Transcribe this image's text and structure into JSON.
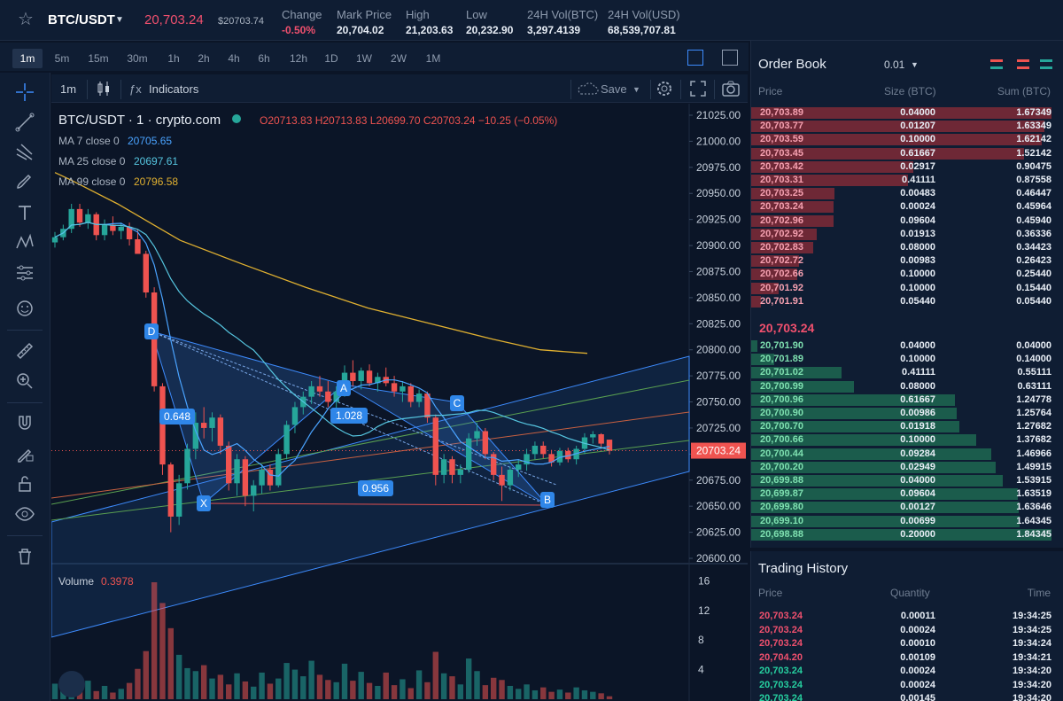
{
  "header": {
    "pair": "BTC/USDT",
    "last_price": "20,703.24",
    "last_price_usd": "$20703.74",
    "stats": [
      {
        "label": "Change",
        "value": "-0.50%",
        "negative": true
      },
      {
        "label": "Mark Price",
        "value": "20,704.02",
        "negative": false
      },
      {
        "label": "High",
        "value": "21,203.63",
        "negative": false
      },
      {
        "label": "Low",
        "value": "20,232.90",
        "negative": false
      },
      {
        "label": "24H Vol(BTC)",
        "value": "3,297.4139",
        "negative": false
      },
      {
        "label": "24H Vol(USD)",
        "value": "68,539,707.81",
        "negative": false
      }
    ]
  },
  "intervals": [
    "1m",
    "5m",
    "15m",
    "30m",
    "1h",
    "2h",
    "4h",
    "6h",
    "12h",
    "1D",
    "1W",
    "2W",
    "1M"
  ],
  "active_interval": "1m",
  "chart_toolbar": {
    "interval": "1m",
    "indicators_label": "Indicators",
    "save_label": "Save"
  },
  "chart_legend": {
    "title": "BTC/USDT · 1 · crypto.com",
    "ohlc": "O20713.83 H20713.83 L20699.70 C20703.24 −10.25 (−0.05%)",
    "ma7_label": "MA 7 close 0",
    "ma7_value": "20705.65",
    "ma25_label": "MA 25 close 0",
    "ma25_value": "20697.61",
    "ma99_label": "MA 99 close 0",
    "ma99_value": "20796.58",
    "volume_label": "Volume",
    "volume_value": "0.3978"
  },
  "colors": {
    "up": "#26a69a",
    "down": "#ef5350",
    "ma7": "#4aa3ff",
    "ma25": "#56c6e0",
    "ma99": "#e0b030",
    "background": "#0b1527",
    "panel": "#0f1d33"
  },
  "chart_data": {
    "type": "candlestick",
    "price_axis_ticks": [
      "21025.00",
      "21000.00",
      "20975.00",
      "20950.00",
      "20925.00",
      "20900.00",
      "20875.00",
      "20850.00",
      "20825.00",
      "20800.00",
      "20775.00",
      "20750.00",
      "20725.00",
      "20700.00",
      "20675.00",
      "20650.00",
      "20625.00",
      "20600.00"
    ],
    "price_range": [
      20600,
      21025
    ],
    "current_price_label": "20703.24",
    "current_price": 20703.24,
    "volume_axis_ticks": [
      "16",
      "12",
      "8",
      "4"
    ],
    "volume_range": [
      0,
      16
    ],
    "pattern_points": [
      "X",
      "A",
      "B",
      "C",
      "D"
    ],
    "pattern_ratios": [
      "0.648",
      "1.028",
      "0.956"
    ],
    "candles": [
      {
        "o": 20903,
        "h": 20913,
        "l": 20898,
        "c": 20908
      },
      {
        "o": 20908,
        "h": 20920,
        "l": 20905,
        "c": 20916
      },
      {
        "o": 20916,
        "h": 20940,
        "l": 20912,
        "c": 20935
      },
      {
        "o": 20935,
        "h": 20940,
        "l": 20918,
        "c": 20922
      },
      {
        "o": 20922,
        "h": 20935,
        "l": 20916,
        "c": 20930
      },
      {
        "o": 20930,
        "h": 20932,
        "l": 20905,
        "c": 20910
      },
      {
        "o": 20910,
        "h": 20925,
        "l": 20905,
        "c": 20920
      },
      {
        "o": 20920,
        "h": 20928,
        "l": 20910,
        "c": 20914
      },
      {
        "o": 20914,
        "h": 20922,
        "l": 20906,
        "c": 20918
      },
      {
        "o": 20918,
        "h": 20922,
        "l": 20900,
        "c": 20906
      },
      {
        "o": 20906,
        "h": 20915,
        "l": 20895,
        "c": 20892
      },
      {
        "o": 20892,
        "h": 20895,
        "l": 20850,
        "c": 20855
      },
      {
        "o": 20855,
        "h": 20860,
        "l": 20760,
        "c": 20765
      },
      {
        "o": 20765,
        "h": 20768,
        "l": 20680,
        "c": 20690
      },
      {
        "o": 20690,
        "h": 20692,
        "l": 20625,
        "c": 20640
      },
      {
        "o": 20640,
        "h": 20680,
        "l": 20632,
        "c": 20672
      },
      {
        "o": 20672,
        "h": 20710,
        "l": 20666,
        "c": 20705
      },
      {
        "o": 20705,
        "h": 20740,
        "l": 20695,
        "c": 20730
      },
      {
        "o": 20730,
        "h": 20745,
        "l": 20715,
        "c": 20725
      },
      {
        "o": 20725,
        "h": 20740,
        "l": 20712,
        "c": 20735
      },
      {
        "o": 20735,
        "h": 20738,
        "l": 20700,
        "c": 20708
      },
      {
        "o": 20708,
        "h": 20712,
        "l": 20665,
        "c": 20672
      },
      {
        "o": 20672,
        "h": 20700,
        "l": 20660,
        "c": 20695
      },
      {
        "o": 20695,
        "h": 20698,
        "l": 20650,
        "c": 20660
      },
      {
        "o": 20660,
        "h": 20675,
        "l": 20645,
        "c": 20670
      },
      {
        "o": 20670,
        "h": 20690,
        "l": 20662,
        "c": 20685
      },
      {
        "o": 20685,
        "h": 20690,
        "l": 20665,
        "c": 20670
      },
      {
        "o": 20670,
        "h": 20705,
        "l": 20668,
        "c": 20700
      },
      {
        "o": 20700,
        "h": 20732,
        "l": 20695,
        "c": 20728
      },
      {
        "o": 20728,
        "h": 20750,
        "l": 20720,
        "c": 20745
      },
      {
        "o": 20745,
        "h": 20760,
        "l": 20738,
        "c": 20755
      },
      {
        "o": 20755,
        "h": 20770,
        "l": 20748,
        "c": 20765
      },
      {
        "o": 20765,
        "h": 20775,
        "l": 20755,
        "c": 20760
      },
      {
        "o": 20760,
        "h": 20770,
        "l": 20745,
        "c": 20750
      },
      {
        "o": 20750,
        "h": 20765,
        "l": 20742,
        "c": 20760
      },
      {
        "o": 20760,
        "h": 20785,
        "l": 20755,
        "c": 20778
      },
      {
        "o": 20778,
        "h": 20790,
        "l": 20765,
        "c": 20770
      },
      {
        "o": 20770,
        "h": 20783,
        "l": 20762,
        "c": 20780
      },
      {
        "o": 20780,
        "h": 20786,
        "l": 20765,
        "c": 20768
      },
      {
        "o": 20768,
        "h": 20778,
        "l": 20760,
        "c": 20774
      },
      {
        "o": 20774,
        "h": 20783,
        "l": 20765,
        "c": 20768
      },
      {
        "o": 20768,
        "h": 20775,
        "l": 20755,
        "c": 20760
      },
      {
        "o": 20760,
        "h": 20770,
        "l": 20750,
        "c": 20765
      },
      {
        "o": 20765,
        "h": 20768,
        "l": 20745,
        "c": 20750
      },
      {
        "o": 20750,
        "h": 20762,
        "l": 20745,
        "c": 20758
      },
      {
        "o": 20758,
        "h": 20760,
        "l": 20730,
        "c": 20735
      },
      {
        "o": 20735,
        "h": 20738,
        "l": 20670,
        "c": 20680
      },
      {
        "o": 20680,
        "h": 20700,
        "l": 20672,
        "c": 20695
      },
      {
        "o": 20695,
        "h": 20698,
        "l": 20672,
        "c": 20680
      },
      {
        "o": 20680,
        "h": 20690,
        "l": 20672,
        "c": 20685
      },
      {
        "o": 20685,
        "h": 20720,
        "l": 20682,
        "c": 20715
      },
      {
        "o": 20715,
        "h": 20730,
        "l": 20708,
        "c": 20722
      },
      {
        "o": 20722,
        "h": 20725,
        "l": 20695,
        "c": 20700
      },
      {
        "o": 20700,
        "h": 20702,
        "l": 20675,
        "c": 20680
      },
      {
        "o": 20680,
        "h": 20688,
        "l": 20655,
        "c": 20670
      },
      {
        "o": 20670,
        "h": 20688,
        "l": 20665,
        "c": 20685
      },
      {
        "o": 20685,
        "h": 20695,
        "l": 20678,
        "c": 20690
      },
      {
        "o": 20690,
        "h": 20705,
        "l": 20684,
        "c": 20700
      },
      {
        "o": 20700,
        "h": 20712,
        "l": 20695,
        "c": 20708
      },
      {
        "o": 20708,
        "h": 20712,
        "l": 20696,
        "c": 20700
      },
      {
        "o": 20700,
        "h": 20704,
        "l": 20688,
        "c": 20692
      },
      {
        "o": 20692,
        "h": 20706,
        "l": 20689,
        "c": 20703
      },
      {
        "o": 20703,
        "h": 20706,
        "l": 20692,
        "c": 20695
      },
      {
        "o": 20695,
        "h": 20708,
        "l": 20690,
        "c": 20705
      },
      {
        "o": 20705,
        "h": 20720,
        "l": 20700,
        "c": 20716
      },
      {
        "o": 20716,
        "h": 20722,
        "l": 20710,
        "c": 20719
      },
      {
        "o": 20719,
        "h": 20720,
        "l": 20705,
        "c": 20710
      },
      {
        "o": 20713.83,
        "h": 20713.83,
        "l": 20699.7,
        "c": 20703.24
      }
    ],
    "volumes": [
      2.1,
      1.6,
      3.4,
      1.2,
      2.5,
      1.1,
      1.8,
      0.9,
      1.4,
      2.2,
      4.1,
      6.5,
      15.8,
      13.0,
      9.6,
      6.0,
      4.2,
      3.8,
      4.6,
      2.8,
      3.3,
      2.0,
      3.5,
      2.4,
      1.7,
      3.6,
      2.1,
      2.8,
      4.9,
      4.0,
      3.1,
      5.2,
      3.3,
      2.6,
      2.3,
      4.8,
      2.5,
      3.7,
      2.2,
      1.8,
      3.6,
      1.9,
      2.7,
      1.5,
      3.9,
      2.3,
      6.4,
      3.5,
      3.1,
      2.0,
      5.5,
      3.8,
      1.9,
      2.9,
      2.6,
      1.8,
      1.4,
      2.0,
      1.2,
      1.6,
      1.0,
      1.3,
      0.9,
      1.6,
      1.2,
      1.0,
      0.8,
      0.4
    ],
    "ma99": [
      [
        0,
        20970
      ],
      [
        10,
        20963
      ],
      [
        40,
        20940
      ],
      [
        80,
        20905
      ],
      [
        120,
        20882
      ],
      [
        160,
        20860
      ],
      [
        200,
        20840
      ],
      [
        240,
        20825
      ],
      [
        280,
        20810
      ],
      [
        310,
        20800
      ],
      [
        340,
        20796.58
      ]
    ]
  },
  "orderbook": {
    "title": "Order Book",
    "aggregation": "0.01",
    "headers": [
      "Price",
      "Size (BTC)",
      "Sum (BTC)"
    ],
    "mid_price": "20,703.24",
    "asks": [
      {
        "price": "20,703.89",
        "size": "0.04000",
        "sum": "1.67349",
        "depth": 1.0
      },
      {
        "price": "20,703.77",
        "size": "0.01207",
        "sum": "1.63349",
        "depth": 0.976
      },
      {
        "price": "20,703.59",
        "size": "0.10000",
        "sum": "1.62142",
        "depth": 0.969
      },
      {
        "price": "20,703.45",
        "size": "0.61667",
        "sum": "1.52142",
        "depth": 0.909
      },
      {
        "price": "20,703.42",
        "size": "0.02917",
        "sum": "0.90475",
        "depth": 0.541
      },
      {
        "price": "20,703.31",
        "size": "0.41111",
        "sum": "0.87558",
        "depth": 0.523
      },
      {
        "price": "20,703.25",
        "size": "0.00483",
        "sum": "0.46447",
        "depth": 0.278
      },
      {
        "price": "20,703.24",
        "size": "0.00024",
        "sum": "0.45964",
        "depth": 0.275
      },
      {
        "price": "20,702.96",
        "size": "0.09604",
        "sum": "0.45940",
        "depth": 0.275
      },
      {
        "price": "20,702.92",
        "size": "0.01913",
        "sum": "0.36336",
        "depth": 0.217
      },
      {
        "price": "20,702.83",
        "size": "0.08000",
        "sum": "0.34423",
        "depth": 0.206
      },
      {
        "price": "20,702.72",
        "size": "0.00983",
        "sum": "0.26423",
        "depth": 0.158
      },
      {
        "price": "20,702.66",
        "size": "0.10000",
        "sum": "0.25440",
        "depth": 0.152
      },
      {
        "price": "20,701.92",
        "size": "0.10000",
        "sum": "0.15440",
        "depth": 0.092
      },
      {
        "price": "20,701.91",
        "size": "0.05440",
        "sum": "0.05440",
        "depth": 0.033
      }
    ],
    "bids": [
      {
        "price": "20,701.90",
        "size": "0.04000",
        "sum": "0.04000",
        "depth": 0.022
      },
      {
        "price": "20,701.89",
        "size": "0.10000",
        "sum": "0.14000",
        "depth": 0.076
      },
      {
        "price": "20,701.02",
        "size": "0.41111",
        "sum": "0.55111",
        "depth": 0.3
      },
      {
        "price": "20,700.99",
        "size": "0.08000",
        "sum": "0.63111",
        "depth": 0.343
      },
      {
        "price": "20,700.96",
        "size": "0.61667",
        "sum": "1.24778",
        "depth": 0.678
      },
      {
        "price": "20,700.90",
        "size": "0.00986",
        "sum": "1.25764",
        "depth": 0.684
      },
      {
        "price": "20,700.70",
        "size": "0.01918",
        "sum": "1.27682",
        "depth": 0.694
      },
      {
        "price": "20,700.66",
        "size": "0.10000",
        "sum": "1.37682",
        "depth": 0.749
      },
      {
        "price": "20,700.44",
        "size": "0.09284",
        "sum": "1.46966",
        "depth": 0.799
      },
      {
        "price": "20,700.20",
        "size": "0.02949",
        "sum": "1.49915",
        "depth": 0.815
      },
      {
        "price": "20,699.88",
        "size": "0.04000",
        "sum": "1.53915",
        "depth": 0.837
      },
      {
        "price": "20,699.87",
        "size": "0.09604",
        "sum": "1.63519",
        "depth": 0.889
      },
      {
        "price": "20,699.80",
        "size": "0.00127",
        "sum": "1.63646",
        "depth": 0.89
      },
      {
        "price": "20,699.10",
        "size": "0.00699",
        "sum": "1.64345",
        "depth": 0.894
      },
      {
        "price": "20,698.88",
        "size": "0.20000",
        "sum": "1.84345",
        "depth": 1.0
      }
    ]
  },
  "history": {
    "title": "Trading History",
    "headers": [
      "Price",
      "Quantity",
      "Time"
    ],
    "rows": [
      {
        "price": "20,703.24",
        "qty": "0.00011",
        "time": "19:34:25",
        "side": "sell"
      },
      {
        "price": "20,703.24",
        "qty": "0.00024",
        "time": "19:34:25",
        "side": "sell"
      },
      {
        "price": "20,703.24",
        "qty": "0.00010",
        "time": "19:34:24",
        "side": "sell"
      },
      {
        "price": "20,704.20",
        "qty": "0.00109",
        "time": "19:34:21",
        "side": "sell"
      },
      {
        "price": "20,703.24",
        "qty": "0.00024",
        "time": "19:34:20",
        "side": "buy"
      },
      {
        "price": "20,703.24",
        "qty": "0.00024",
        "time": "19:34:20",
        "side": "buy"
      },
      {
        "price": "20,703.24",
        "qty": "0.00145",
        "time": "19:34:20",
        "side": "buy"
      }
    ]
  },
  "icons": [
    "star-icon",
    "crosshair-icon",
    "trendline-icon",
    "pitchfork-icon",
    "brush-icon",
    "text-icon",
    "pattern-icon",
    "prediction-icon",
    "emoji-icon",
    "ruler-icon",
    "zoom-in-icon",
    "magnet-icon",
    "lock-draw-icon",
    "lock-icon",
    "eye-icon",
    "trash-icon",
    "candle-type-icon",
    "cloud-icon",
    "gear-icon",
    "fullscreen-icon",
    "camera-icon"
  ]
}
